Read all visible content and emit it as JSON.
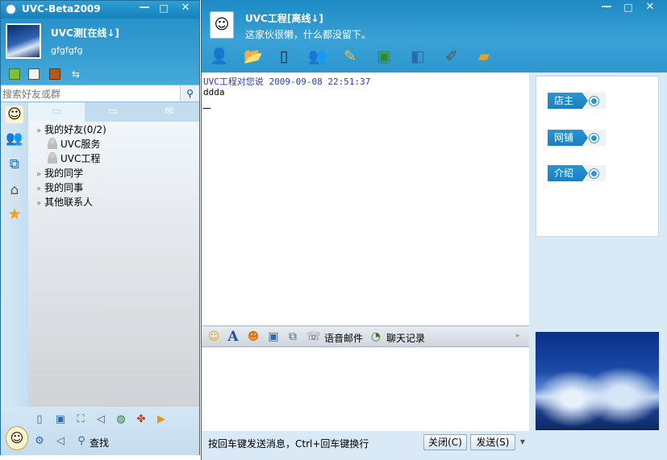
{
  "left_window": {
    "title": "UVC-Beta2009",
    "controls": {
      "minimize": "—",
      "maximize": "□",
      "close": "✕"
    },
    "user": {
      "nickname": "UVC测[在线↓]",
      "signature": "gfgfgfg"
    },
    "search": {
      "placeholder": "搜索好友或群"
    },
    "groups": [
      {
        "label": "我的好友(0/2)",
        "contacts": [
          "UVC服务",
          "UVC工程"
        ]
      },
      {
        "label": "我的同学"
      },
      {
        "label": "我的同事"
      },
      {
        "label": "其他联系人"
      }
    ],
    "find_label": "查找"
  },
  "chat_window": {
    "controls": {
      "minimize": "—",
      "maximize": "□",
      "close": "✕"
    },
    "contact": {
      "name": "UVC工程[离线↓]",
      "signature": "这家伙很懒，什么都没留下。"
    },
    "message": {
      "header": "UVC工程对您说 2009-09-08 22:51:37",
      "body": "ddda"
    },
    "format_bar": {
      "voice_mail": "语音邮件",
      "chat_history": "聊天记录"
    },
    "send_bar": {
      "tip": "按回车键发送消息，Ctrl+回车键换行",
      "close_button": "关闭(C)",
      "send_button": "发送(S)"
    },
    "side_panel": {
      "tags": [
        "店主",
        "网铺",
        "介绍"
      ]
    }
  },
  "colors": {
    "title_bar": "#1480bd",
    "header_blue": "#2d97cf",
    "tag_blue": "#2a95d2",
    "message_header": "#2b3cb5"
  }
}
